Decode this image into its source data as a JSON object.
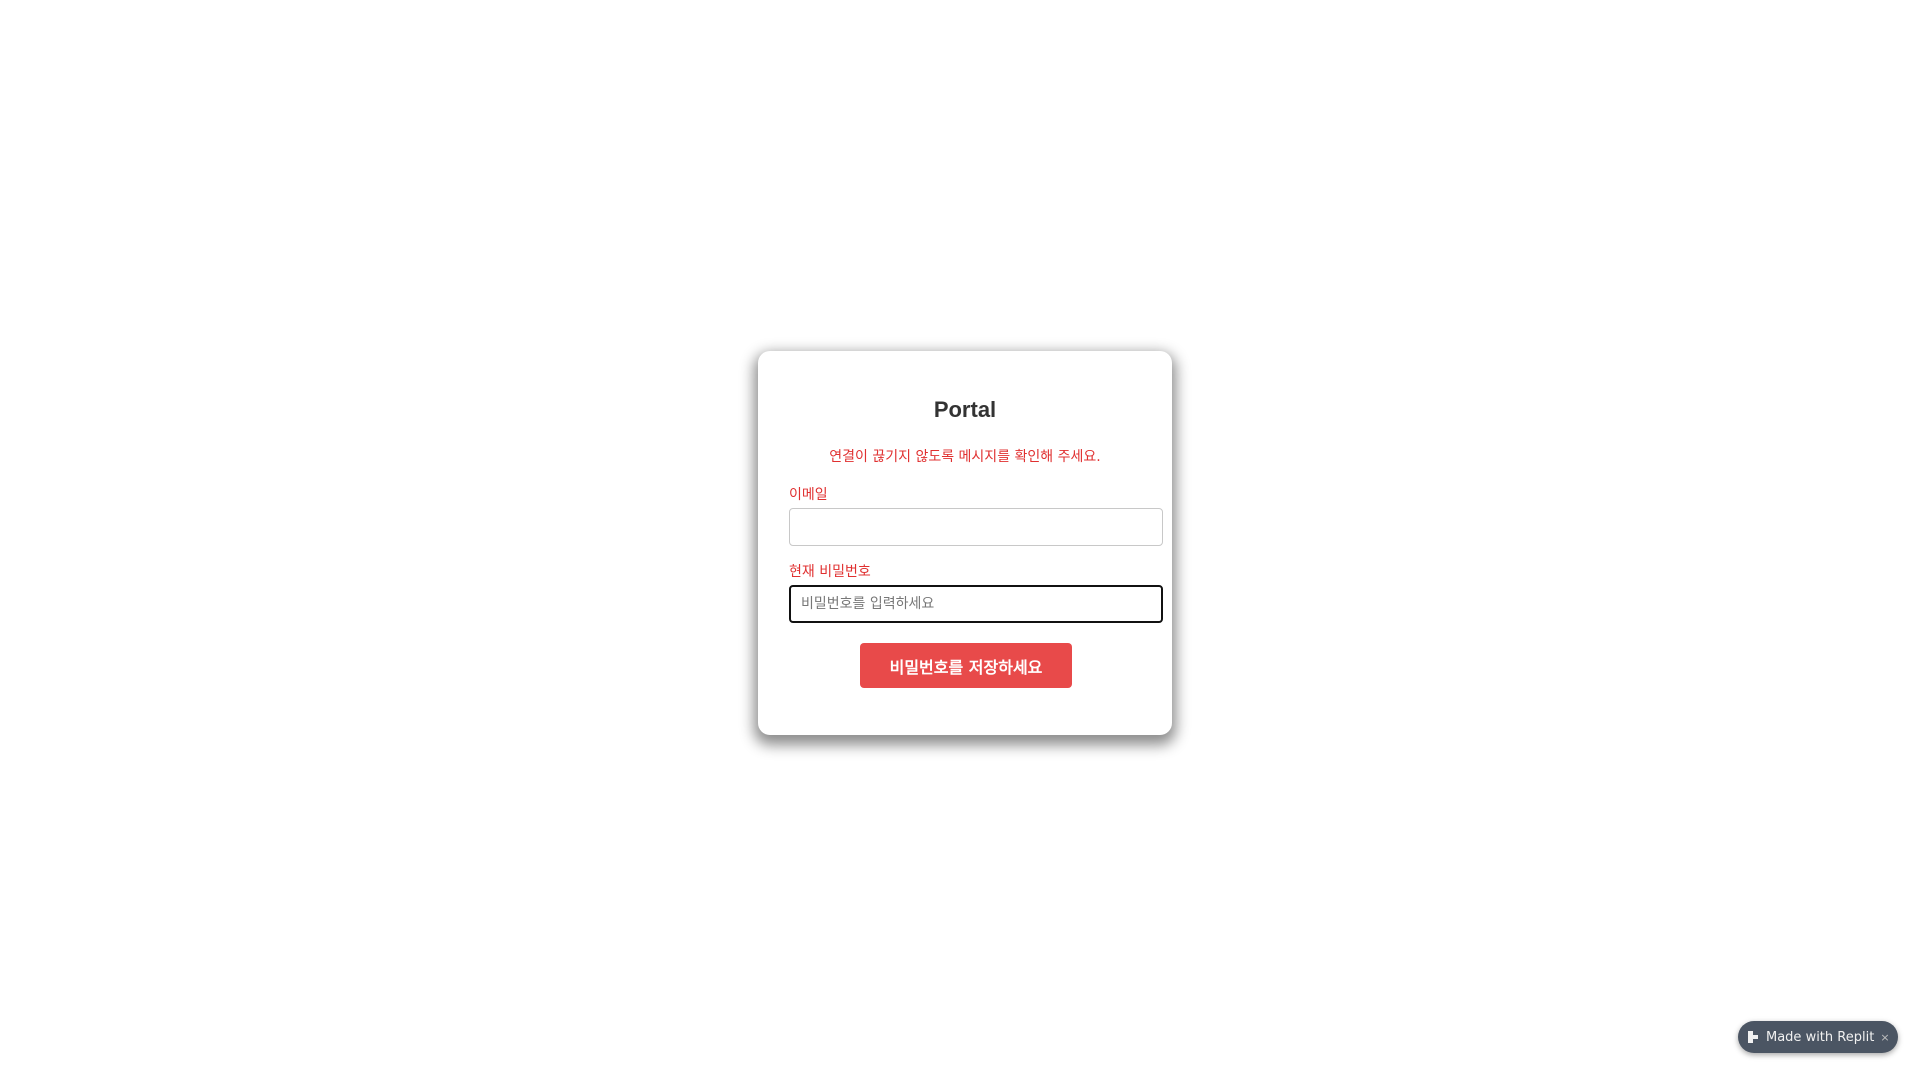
{
  "login_card": {
    "title": "Portal",
    "notice": "연결이 끊기지 않도록 메시지를 확인해 주세요.",
    "email_label": "이메일",
    "email_value": "",
    "password_label": "현재 비밀번호",
    "password_placeholder": "비밀번호를 입력하세요",
    "save_button_label": "비밀번호를 저장하세요"
  },
  "badge": {
    "text": "Made with Replit",
    "close_symbol": "×",
    "icon": "replit-icon"
  },
  "colors": {
    "accent_red": "#e84a4a",
    "label_red": "#e03030",
    "badge_bg": "#4b5563"
  }
}
